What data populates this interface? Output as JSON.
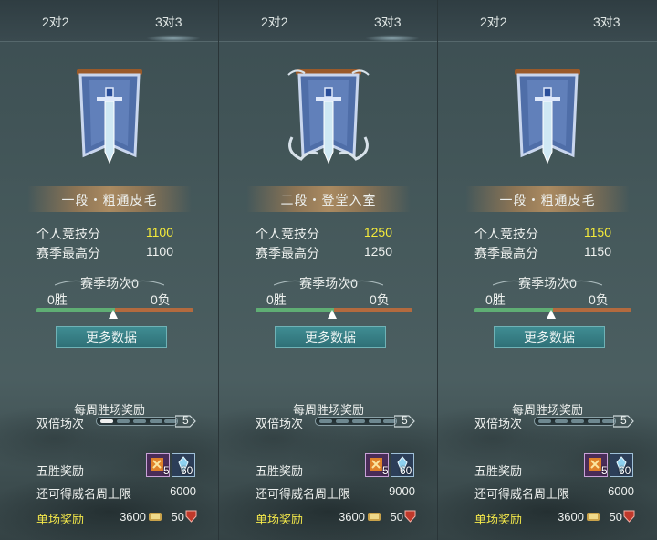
{
  "panels": [
    {
      "tabs": [
        "2对2",
        "3对3"
      ],
      "rank_title": "一段・粗通皮毛",
      "score_label": "个人竞技分",
      "score_value": "1100",
      "best_label": "赛季最高分",
      "best_value": "1100",
      "season_title": "赛季场次0",
      "wins": "0胜",
      "losses": "0负",
      "more_button": "更多数据",
      "weekly_title": "每周胜场奖励",
      "double_label": "双倍场次",
      "double_count": "5",
      "five_wins_label": "五胜奖励",
      "item_a_count": "5",
      "item_b_count": "60",
      "cap_label": "还可得威名周上限",
      "cap_value": "6000",
      "single_label": "单场奖励",
      "single_a": "3600",
      "single_b": "50"
    },
    {
      "tabs": [
        "2对2",
        "3对3"
      ],
      "rank_title": "二段・登堂入室",
      "score_label": "个人竞技分",
      "score_value": "1250",
      "best_label": "赛季最高分",
      "best_value": "1250",
      "season_title": "赛季场次0",
      "wins": "0胜",
      "losses": "0负",
      "more_button": "更多数据",
      "weekly_title": "每周胜场奖励",
      "double_label": "双倍场次",
      "double_count": "5",
      "five_wins_label": "五胜奖励",
      "item_a_count": "5",
      "item_b_count": "60",
      "cap_label": "还可得威名周上限",
      "cap_value": "9000",
      "single_label": "单场奖励",
      "single_a": "3600",
      "single_b": "50"
    },
    {
      "tabs": [
        "2对2",
        "3对3"
      ],
      "rank_title": "一段・粗通皮毛",
      "score_label": "个人竞技分",
      "score_value": "1150",
      "best_label": "赛季最高分",
      "best_value": "1150",
      "season_title": "赛季场次0",
      "wins": "0胜",
      "losses": "0负",
      "more_button": "更多数据",
      "weekly_title": "每周胜场奖励",
      "double_label": "双倍场次",
      "double_count": "5",
      "five_wins_label": "五胜奖励",
      "item_a_count": "5",
      "item_b_count": "60",
      "cap_label": "还可得威名周上限",
      "cap_value": "6000",
      "single_label": "单场奖励",
      "single_a": "3600",
      "single_b": "50"
    }
  ],
  "colors": {
    "score_highlight": "#f4ea3a",
    "single_label": "#f4e84a",
    "button_bg": "#3f8c92",
    "win_bar": "#5fae74",
    "loss_bar": "#b36a3e"
  },
  "icons": {
    "banner": "sword-banner-icon",
    "coin": "coin-icon",
    "shield": "shield-icon",
    "item_a": "scroll-item-icon",
    "item_b": "crystal-item-icon",
    "marker": "triangle-marker-icon"
  }
}
